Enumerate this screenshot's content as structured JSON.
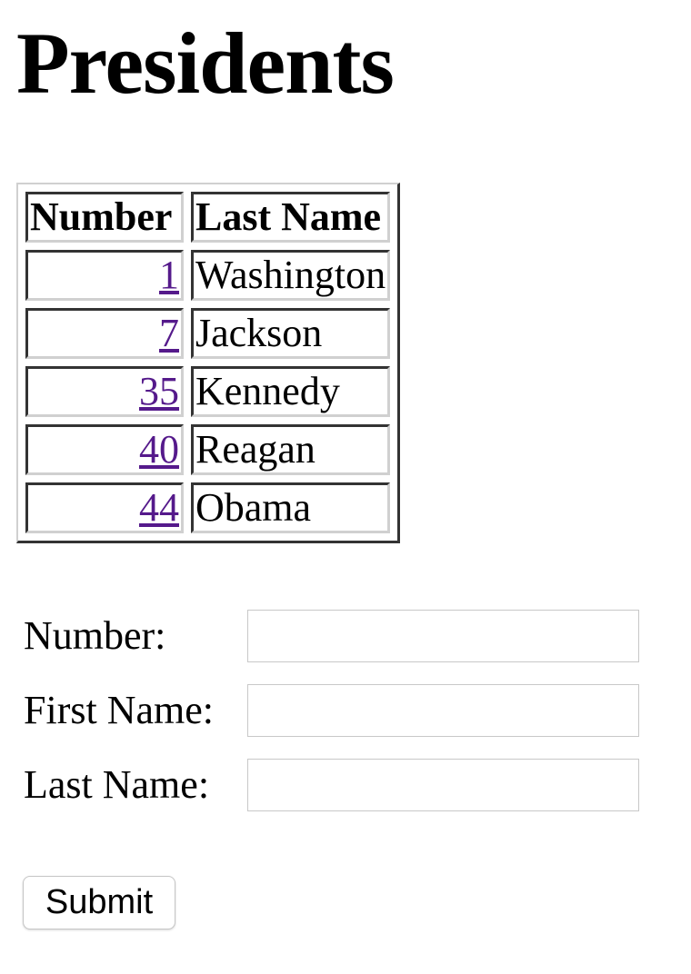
{
  "page": {
    "title": "Presidents"
  },
  "table": {
    "headers": {
      "number": "Number",
      "last_name": "Last Name"
    },
    "rows": [
      {
        "number": "1",
        "last_name": "Washington"
      },
      {
        "number": "7",
        "last_name": "Jackson"
      },
      {
        "number": "35",
        "last_name": "Kennedy"
      },
      {
        "number": "40",
        "last_name": "Reagan"
      },
      {
        "number": "44",
        "last_name": "Obama"
      }
    ]
  },
  "form": {
    "number_label": "Number:",
    "number_value": "",
    "first_name_label": "First Name:",
    "first_name_value": "",
    "last_name_label": "Last Name:",
    "last_name_value": "",
    "submit_label": "Submit"
  },
  "colors": {
    "visited_link": "#551a8b",
    "text": "#000000",
    "input_border": "#c8c8c8"
  }
}
